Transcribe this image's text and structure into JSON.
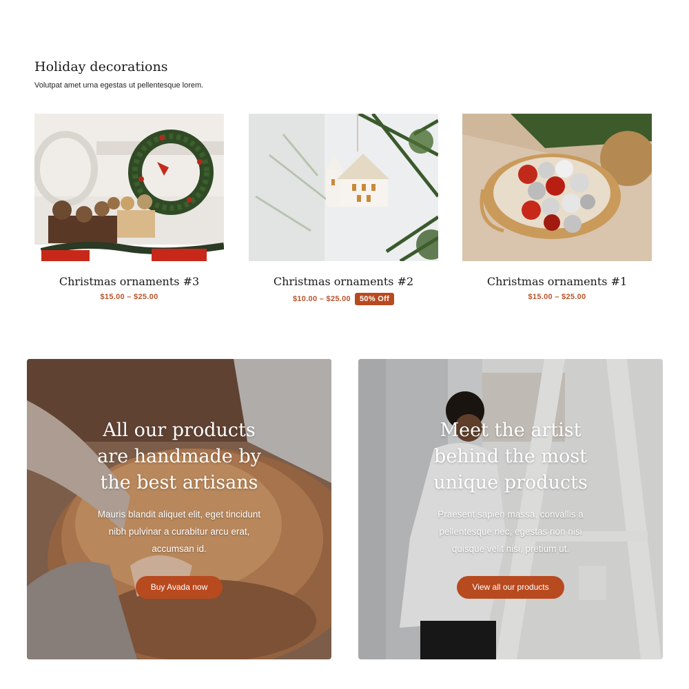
{
  "section": {
    "title": "Holiday decorations",
    "subtitle": "Volutpat amet urna egestas ut pellentesque lorem."
  },
  "products": [
    {
      "name": "Christmas ornaments #3",
      "price": "$15.00 – $25.00",
      "badge": ""
    },
    {
      "name": "Christmas ornaments #2",
      "price": "$10.00 – $25.00",
      "badge": "50% Off"
    },
    {
      "name": "Christmas ornaments #1",
      "price": "$15.00 – $25.00",
      "badge": ""
    }
  ],
  "promos": [
    {
      "title": "All our products are handmade by the best artisans",
      "description": "Mauris blandit aliquet elit, eget tincidunt nibh pulvinar a curabitur arcu erat, accumsan id.",
      "button": "Buy Avada now"
    },
    {
      "title": "Meet the artist behind the most unique products",
      "description": "Praesent sapien massa, convallis a pellentesque nec, egestas non nisi quisque velit nisi, pretium ut.",
      "button": "View all our products"
    }
  ],
  "colors": {
    "accent": "#b84a1f",
    "price": "#b8532a"
  }
}
